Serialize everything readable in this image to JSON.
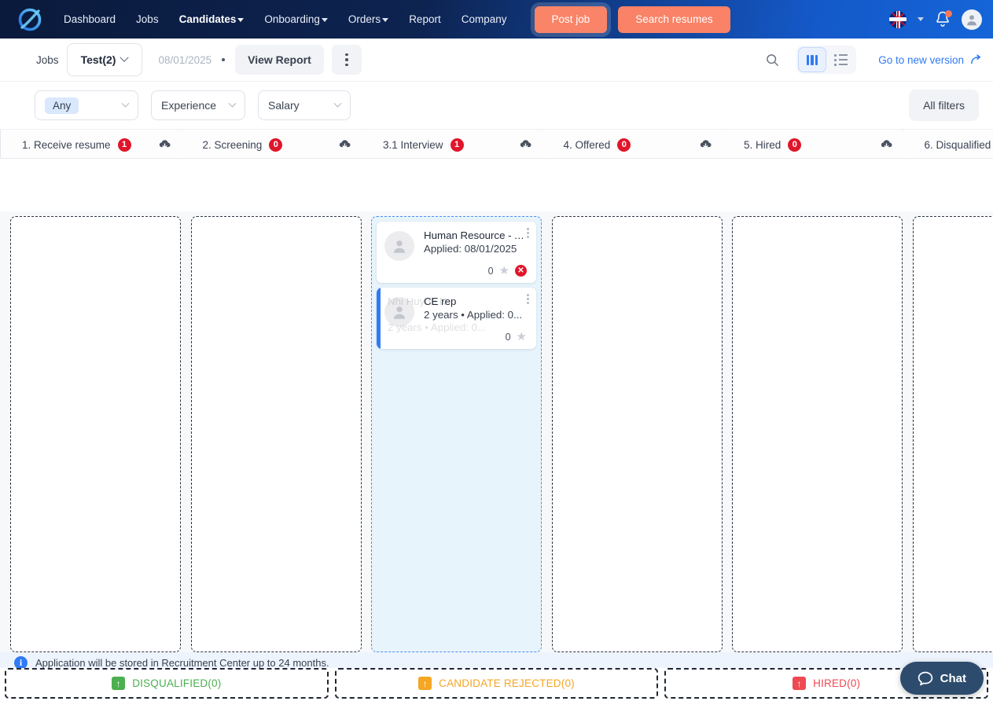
{
  "topnav": {
    "logo_name": "brand-logo",
    "links": [
      {
        "label": "Dashboard",
        "active": false,
        "caret": false
      },
      {
        "label": "Jobs",
        "active": false,
        "caret": false
      },
      {
        "label": "Candidates",
        "active": true,
        "caret": true
      },
      {
        "label": "Onboarding",
        "active": false,
        "caret": true
      },
      {
        "label": "Orders",
        "active": false,
        "caret": true
      },
      {
        "label": "Report",
        "active": false,
        "caret": false
      },
      {
        "label": "Company",
        "active": false,
        "caret": false
      }
    ],
    "post_job_label": "Post job",
    "search_resumes_label": "Search resumes",
    "language_flag": "uk-flag-icon",
    "accent_orange": "#f98267"
  },
  "toolbar": {
    "jobs_label": "Jobs",
    "job_selected": "Test(2)",
    "date": "08/01/2025",
    "view_report_label": "View Report",
    "more_menu": "kebab-menu",
    "search_icon": "search-icon",
    "view_kanban": "kanban-view-icon",
    "view_list": "list-view-icon",
    "active_view": "kanban",
    "new_version_label": "Go to new version",
    "new_version_color": "#2f7af5"
  },
  "filters": {
    "any_chip": "Any",
    "experience_label": "Experience",
    "salary_label": "Salary",
    "all_filters_label": "All filters"
  },
  "stages": [
    {
      "name": "1. Receive resume",
      "count": "1",
      "active": false
    },
    {
      "name": "2. Screening",
      "count": "0",
      "active": false
    },
    {
      "name": "3.1 Interview",
      "count": "1",
      "active": true
    },
    {
      "name": "4. Offered",
      "count": "0",
      "active": false
    },
    {
      "name": "5. Hired",
      "count": "0",
      "active": false
    },
    {
      "name": "6. Disqualified",
      "count": "",
      "active": false
    }
  ],
  "cards": [
    {
      "title": "Human Resource - Ad...",
      "subtitle": "Applied: 08/01/2025",
      "rating": "0",
      "star": "★",
      "rejected_badge": "✕",
      "has_reject": true,
      "accent": false,
      "ghost": null
    },
    {
      "title": "CE rep",
      "subtitle": "2 years  •  Applied: 0...",
      "rating": "0",
      "star": "★",
      "has_reject": false,
      "accent": true,
      "ghost": {
        "title": "Nhi Huynh N...",
        "sub": "2 years  •  Applied: 0..."
      }
    }
  ],
  "notice": {
    "icon": "info-icon",
    "text": "Application will be stored in Recruitment Center up to 24 months."
  },
  "dropzones": [
    {
      "label": "DISQUALIFIED(0)",
      "color": "green",
      "icon": "up-arrow-icon"
    },
    {
      "label": "CANDIDATE REJECTED(0)",
      "color": "orange",
      "icon": "up-arrow-icon"
    },
    {
      "label": "HIRED(0)",
      "color": "red",
      "icon": "up-arrow-icon"
    }
  ],
  "chat": {
    "label": "Chat",
    "icon": "speech-bubble-icon"
  }
}
